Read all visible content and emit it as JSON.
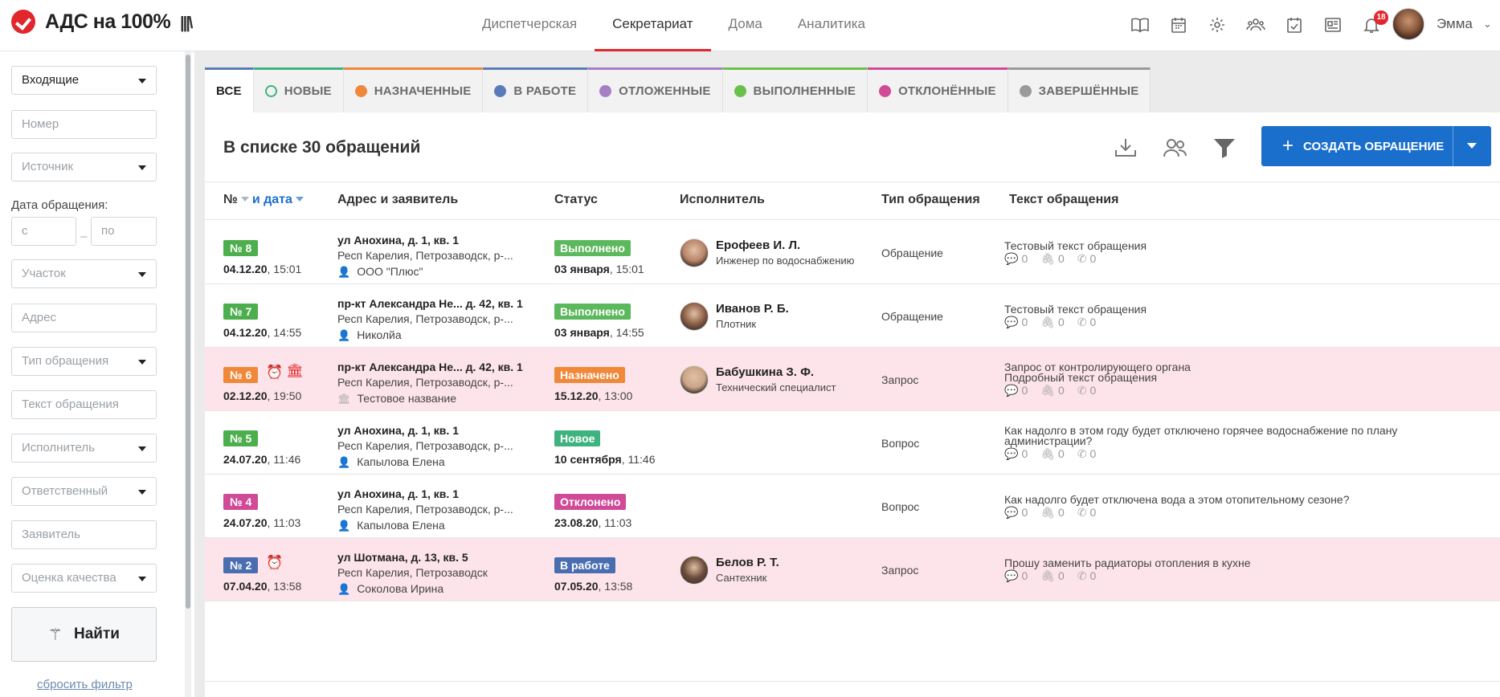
{
  "app": {
    "logo_text": "АДС на 100%"
  },
  "nav": {
    "items": [
      "Диспетчерская",
      "Секретариат",
      "Дома",
      "Аналитика"
    ],
    "active": "Секретариат"
  },
  "header": {
    "notifications_count": "18",
    "user_name": "Эмма",
    "icons": [
      "book-icon",
      "calendar-icon",
      "gear-icon",
      "users-icon",
      "calendar-check-icon",
      "newspaper-icon",
      "bell-icon"
    ]
  },
  "sidebar": {
    "folder": "Входящие",
    "number_placeholder": "Номер",
    "source": "Источник",
    "date_label": "Дата обращения:",
    "date_from_placeholder": "с",
    "date_to_placeholder": "по",
    "district": "Участок",
    "address_placeholder": "Адрес",
    "request_type": "Тип обращения",
    "request_text_placeholder": "Текст обращения",
    "executor": "Исполнитель",
    "responsible": "Ответственный",
    "applicant_placeholder": "Заявитель",
    "quality": "Оценка качества",
    "find_label": "Найти",
    "reset_label": "сбросить фильтр"
  },
  "tabs": [
    {
      "label": "ВСЕ",
      "color": "#5b7bb8"
    },
    {
      "label": "НОВЫЕ",
      "color": "#3fb37f"
    },
    {
      "label": "НАЗНАЧЕННЫЕ",
      "color": "#f0883a"
    },
    {
      "label": "В РАБОТЕ",
      "color": "#5b7bb8"
    },
    {
      "label": "ОТЛОЖЕННЫЕ",
      "color": "#a77ec4"
    },
    {
      "label": "ВЫПОЛНЕННЫЕ",
      "color": "#69c04a"
    },
    {
      "label": "ОТКЛОНЁННЫЕ",
      "color": "#d04a98"
    },
    {
      "label": "ЗАВЕРШЁННЫЕ",
      "color": "#9a9a9a"
    }
  ],
  "list": {
    "title": "В списке 30 обращений",
    "create_label": "СОЗДАТЬ ОБРАЩЕНИЕ"
  },
  "table": {
    "headers": {
      "num": "№",
      "date": "и дата",
      "address": "Адрес и заявитель",
      "status": "Статус",
      "executor": "Исполнитель",
      "type": "Тип обращения",
      "text": "Текст обращения"
    },
    "rows": [
      {
        "num": "№ 8",
        "num_color": "#4cae4c",
        "date_b": "04.12.20",
        "date_t": ", 15:01",
        "addr1": "ул Анохина, д. 1, кв. 1",
        "addr2": "Респ Карелия, Петрозаводск, р-...",
        "applicant": "ООО \"Плюс\"",
        "applicant_icon": "user-icon",
        "status": "Выполнено",
        "status_color": "#5cb85c",
        "sdate_b": "03 января",
        "sdate_t": ", 15:01",
        "executor": "Ерофеев И. Л.",
        "role": "Инженер по водоснабжению",
        "type": "Обращение",
        "text": [
          "Тестовый текст обращения"
        ],
        "comments": "0",
        "files": "0",
        "calls": "0",
        "pink": false,
        "alarm": false,
        "bank": false
      },
      {
        "num": "№ 7",
        "num_color": "#4cae4c",
        "date_b": "04.12.20",
        "date_t": ", 14:55",
        "addr1": "пр-кт Александра Не... д. 42, кв. 1",
        "addr2": "Респ Карелия, Петрозаводск, р-...",
        "applicant": "Николйа",
        "applicant_icon": "user-icon",
        "status": "Выполнено",
        "status_color": "#5cb85c",
        "sdate_b": "03 января",
        "sdate_t": ", 14:55",
        "executor": "Иванов Р. Б.",
        "role": "Плотник",
        "type": "Обращение",
        "text": [
          "Тестовый текст обращения"
        ],
        "comments": "0",
        "files": "0",
        "calls": "0",
        "pink": false,
        "alarm": false,
        "bank": false
      },
      {
        "num": "№ 6",
        "num_color": "#f0883a",
        "date_b": "02.12.20",
        "date_t": ", 19:50",
        "addr1": "пр-кт Александра Не... д. 42, кв. 1",
        "addr2": "Респ Карелия, Петрозаводск, р-...",
        "applicant": "Тестовое название",
        "applicant_icon": "bank-icon",
        "status": "Назначено",
        "status_color": "#f0883a",
        "sdate_b": "15.12.20",
        "sdate_t": ", 13:00",
        "executor": "Бабушкина З. Ф.",
        "role": "Технический специалист",
        "type": "Запрос",
        "text": [
          "Запрос от контролирующего органа",
          "Подробный текст обращения"
        ],
        "comments": "0",
        "files": "0",
        "calls": "0",
        "pink": true,
        "alarm": true,
        "bank": true
      },
      {
        "num": "№ 5",
        "num_color": "#4cae4c",
        "date_b": "24.07.20",
        "date_t": ", 11:46",
        "addr1": "ул Анохина, д. 1, кв. 1",
        "addr2": "Респ Карелия, Петрозаводск, р-...",
        "applicant": "Капылова Елена",
        "applicant_icon": "user-icon",
        "status": "Новое",
        "status_color": "#3fb37f",
        "sdate_b": "10 сентября",
        "sdate_t": ", 11:46",
        "executor": "",
        "role": "",
        "type": "Вопрос",
        "text": [
          "Как надолго в этом году будет отключено горячее водоснабжение по плану",
          "администрации?"
        ],
        "comments": "0",
        "files": "0",
        "calls": "0",
        "pink": false,
        "alarm": false,
        "bank": false
      },
      {
        "num": "№ 4",
        "num_color": "#d04a98",
        "date_b": "24.07.20",
        "date_t": ", 11:03",
        "addr1": "ул Анохина, д. 1, кв. 1",
        "addr2": "Респ Карелия, Петрозаводск, р-...",
        "applicant": "Капылова Елена",
        "applicant_icon": "user-icon",
        "status": "Отклонено",
        "status_color": "#d04a98",
        "sdate_b": "23.08.20",
        "sdate_t": ", 11:03",
        "executor": "",
        "role": "",
        "type": "Вопрос",
        "text": [
          "Как надолго будет отключена вода а этом отопительному сезоне?"
        ],
        "comments": "0",
        "files": "0",
        "calls": "0",
        "pink": false,
        "alarm": false,
        "bank": false
      },
      {
        "num": "№ 2",
        "num_color": "#4a6db0",
        "date_b": "07.04.20",
        "date_t": ", 13:58",
        "addr1": "ул Шотмана, д. 13, кв. 5",
        "addr2": "Респ Карелия, Петрозаводск",
        "applicant": "Соколова Ирина",
        "applicant_icon": "user-icon",
        "status": "В работе",
        "status_color": "#4a6db0",
        "sdate_b": "07.05.20",
        "sdate_t": ", 13:58",
        "executor": "Белов Р. Т.",
        "role": "Сантехник",
        "type": "Запрос",
        "text": [
          "Прошу заменить радиаторы отопления в кухне"
        ],
        "comments": "0",
        "files": "0",
        "calls": "0",
        "pink": true,
        "alarm": true,
        "bank": false
      }
    ]
  }
}
